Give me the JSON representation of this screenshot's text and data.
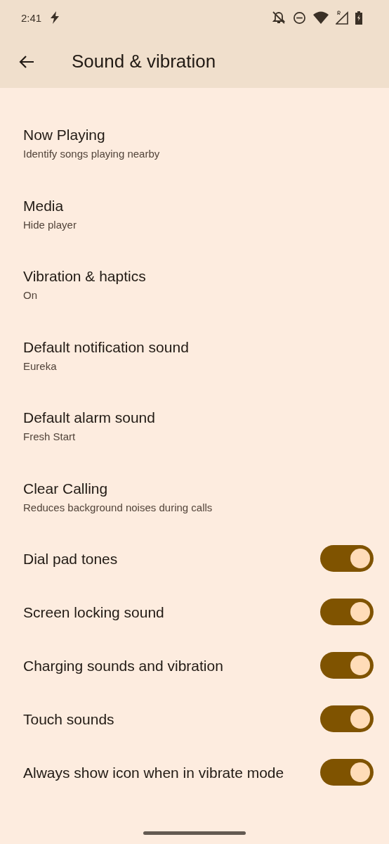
{
  "status_bar": {
    "time": "2:41"
  },
  "app_bar": {
    "title": "Sound & vibration"
  },
  "items": [
    {
      "kind": "link",
      "title": "Now Playing",
      "subtitle": "Identify songs playing nearby"
    },
    {
      "kind": "link",
      "title": "Media",
      "subtitle": "Hide player"
    },
    {
      "kind": "link",
      "title": "Vibration & haptics",
      "subtitle": "On"
    },
    {
      "kind": "link",
      "title": "Default notification sound",
      "subtitle": "Eureka"
    },
    {
      "kind": "link",
      "title": "Default alarm sound",
      "subtitle": "Fresh Start"
    },
    {
      "kind": "link",
      "title": "Clear Calling",
      "subtitle": "Reduces background noises during calls"
    },
    {
      "kind": "toggle",
      "title": "Dial pad tones",
      "on": true
    },
    {
      "kind": "toggle",
      "title": "Screen locking sound",
      "on": true
    },
    {
      "kind": "toggle",
      "title": "Charging sounds and vibration",
      "on": true
    },
    {
      "kind": "toggle",
      "title": "Touch sounds",
      "on": true
    },
    {
      "kind": "toggle",
      "title": "Always show icon when in vibrate mode",
      "on": true
    }
  ]
}
